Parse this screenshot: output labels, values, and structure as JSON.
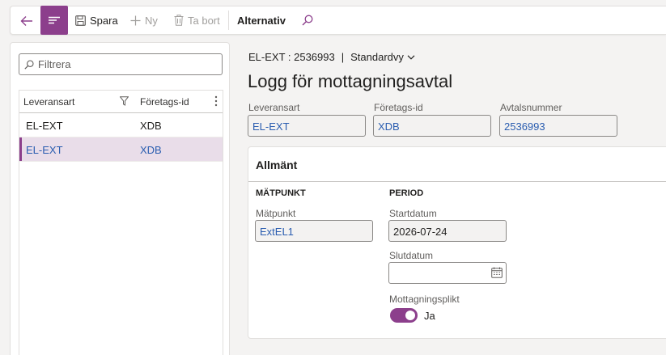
{
  "toolbar": {
    "save_label": "Spara",
    "new_label": "Ny",
    "delete_label": "Ta bort",
    "options_label": "Alternativ"
  },
  "left_panel": {
    "filter_placeholder": "Filtrera",
    "columns": [
      "Leveransart",
      "Företags-id"
    ],
    "rows": [
      {
        "leveransart": "EL-EXT",
        "foretags_id": "XDB",
        "selected": false
      },
      {
        "leveransart": "EL-EXT",
        "foretags_id": "XDB",
        "selected": true
      }
    ]
  },
  "header": {
    "breadcrumb_record": "EL-EXT : 2536993",
    "breadcrumb_sep": "|",
    "view_name": "Standardvy",
    "title": "Logg för mottagningsavtal"
  },
  "header_fields": [
    {
      "label": "Leveransart",
      "value": "EL-EXT"
    },
    {
      "label": "Företags-id",
      "value": "XDB"
    },
    {
      "label": "Avtalsnummer",
      "value": "2536993"
    }
  ],
  "general": {
    "title": "Allmänt",
    "metering_group": "MÄTPUNKT",
    "metering_label": "Mätpunkt",
    "metering_value": "ExtEL1",
    "period_group": "PERIOD",
    "start_label": "Startdatum",
    "start_value": "2026-07-24",
    "end_label": "Slutdatum",
    "end_value": "",
    "obligation_label": "Mottagningsplikt",
    "obligation_value": "Ja",
    "obligation_on": true
  },
  "colors": {
    "accent": "#8c3f8c",
    "link": "#2a5db0",
    "selected_row": "#e9dde9"
  }
}
